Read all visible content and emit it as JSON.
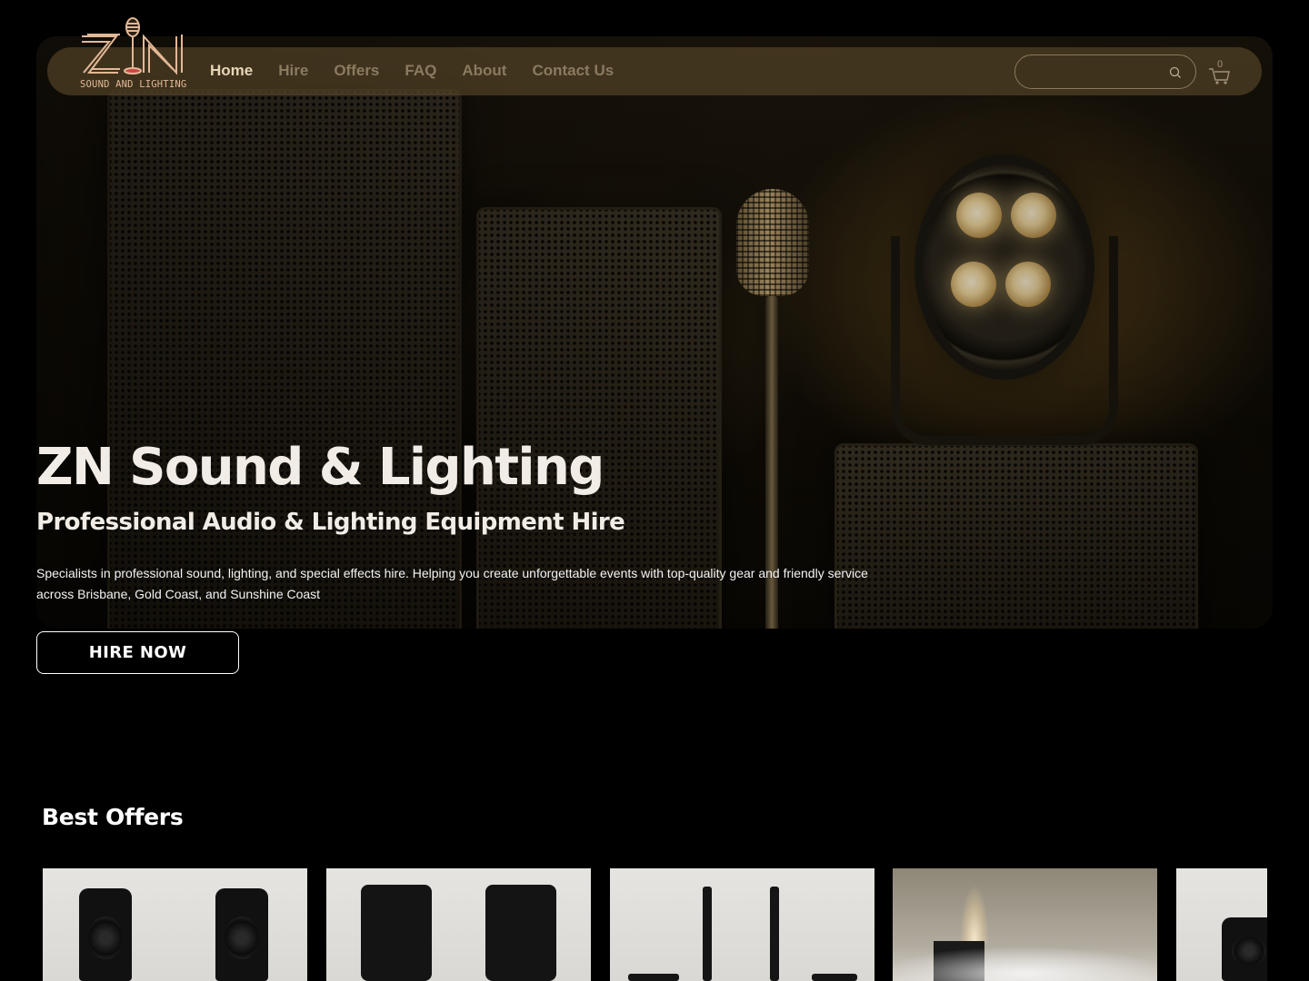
{
  "brand": {
    "logo_letters": "ZN",
    "logo_tagline": "SOUND AND LIGHTING"
  },
  "nav": {
    "items": [
      {
        "label": "Home",
        "active": true
      },
      {
        "label": "Hire",
        "active": false
      },
      {
        "label": "Offers",
        "active": false
      },
      {
        "label": "FAQ",
        "active": false
      },
      {
        "label": "About",
        "active": false
      },
      {
        "label": "Contact Us",
        "active": false
      }
    ]
  },
  "search": {
    "value": "",
    "icon": "search-icon"
  },
  "cart": {
    "count": "0",
    "icon": "cart-icon"
  },
  "hero": {
    "title": "ZN Sound & Lighting",
    "subtitle": "Professional Audio & Lighting Equipment Hire",
    "description": "Specialists in professional sound, lighting, and special effects hire. Helping you create unforgettable events with top-quality gear and friendly service across Brisbane, Gold Coast, and Sunshine Coast",
    "cta_label": "HIRE NOW"
  },
  "offers": {
    "title": "Best Offers"
  },
  "colors": {
    "background": "#000000",
    "header_bar": "#5c4a2c",
    "nav_active": "#e6d6b6",
    "nav_inactive": "#8a7a60",
    "logo_accent": "#e2b896"
  }
}
